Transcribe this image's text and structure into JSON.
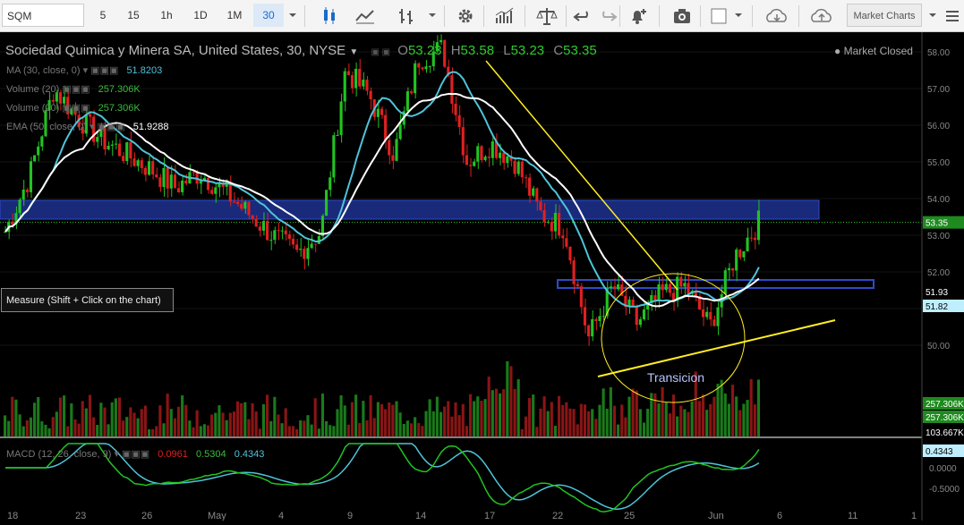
{
  "toolbar": {
    "symbol": "SQM",
    "intervals": [
      "5",
      "15",
      "1h",
      "1D",
      "1M",
      "30"
    ],
    "active_interval": "30",
    "market_charts_label": "Market Charts"
  },
  "header": {
    "title": "Sociedad Quimica y Minera SA, United States, 30, NYSE",
    "o_label": "O",
    "o": "53.23",
    "h_label": "H",
    "h": "53.58",
    "l_label": "L",
    "l": "53.23",
    "c_label": "C",
    "c": "53.35",
    "market_status": "Market Closed"
  },
  "indicators": [
    {
      "label": "MA (30, close, 0)",
      "value": "51.8203",
      "color": "#4fc3d9"
    },
    {
      "label": "Volume (20)",
      "value": "257.306K",
      "color": "#3dbb3d"
    },
    {
      "label": "Volume (20)",
      "value": "257.306K",
      "color": "#3dbb3d"
    },
    {
      "label": "EMA (50, close, 0)",
      "value": "51.9288",
      "color": "#ffffff"
    }
  ],
  "macd": {
    "label": "MACD (12, 26, close, 9)",
    "v1": "0.0961",
    "v2": "0.5304",
    "v3": "0.4343"
  },
  "measure_tooltip": "Measure (Shift + Click on the chart)",
  "annotation": "Transicion",
  "price_axis": {
    "ticks": [
      "58.00",
      "57.00",
      "56.00",
      "55.00",
      "54.00",
      "53.00",
      "52.00",
      "51.00",
      "50.00"
    ],
    "labels": {
      "last": "53.35",
      "ema": "51.93",
      "ma": "51.82",
      "vol1": "257.306K",
      "vol2": "257.306K",
      "vol3": "103.667K"
    }
  },
  "macd_axis": {
    "ticks": [
      "0.5000",
      "0.0000",
      "-0.5000"
    ],
    "label": "0.4343"
  },
  "time_axis": [
    "18",
    "23",
    "26",
    "May",
    "4",
    "9",
    "14",
    "17",
    "22",
    "25",
    "Jun",
    "6",
    "11",
    "1"
  ],
  "colors": {
    "up": "#22c322",
    "down": "#e02020",
    "ma": "#4fc3d9",
    "ema": "#ffffff",
    "trend": "#ffee22",
    "zone": "#1a2a7a",
    "zone_edge": "#2d4cc8"
  },
  "chart_data": {
    "type": "line",
    "title": "Sociedad Quimica y Minera SA, United States, 30, NYSE",
    "y_range": [
      49.5,
      58.3
    ],
    "x_labels": [
      "18",
      "23",
      "26",
      "May",
      "4",
      "9",
      "14",
      "17",
      "22",
      "25",
      "Jun",
      "6",
      "11",
      "1"
    ],
    "close": [
      53.1,
      54.6,
      57.0,
      56.2,
      55.6,
      55.2,
      54.8,
      54.3,
      54.7,
      54.2,
      53.6,
      53.0,
      52.5,
      53.1,
      57.5,
      56.8,
      55.2,
      57.8,
      58.1,
      55.0,
      55.5,
      55.0,
      53.6,
      53.2,
      50.2,
      51.6,
      50.6,
      51.4,
      51.6,
      50.5,
      52.4,
      53.35
    ],
    "series": [
      {
        "name": "MA (30, close, 0)",
        "last": 51.8203
      },
      {
        "name": "EMA (50, close, 0)",
        "last": 51.9288
      }
    ],
    "volume_last": "257.306K",
    "macd": {
      "macd": 0.0961,
      "signal": 0.5304,
      "hist": 0.4343
    }
  }
}
